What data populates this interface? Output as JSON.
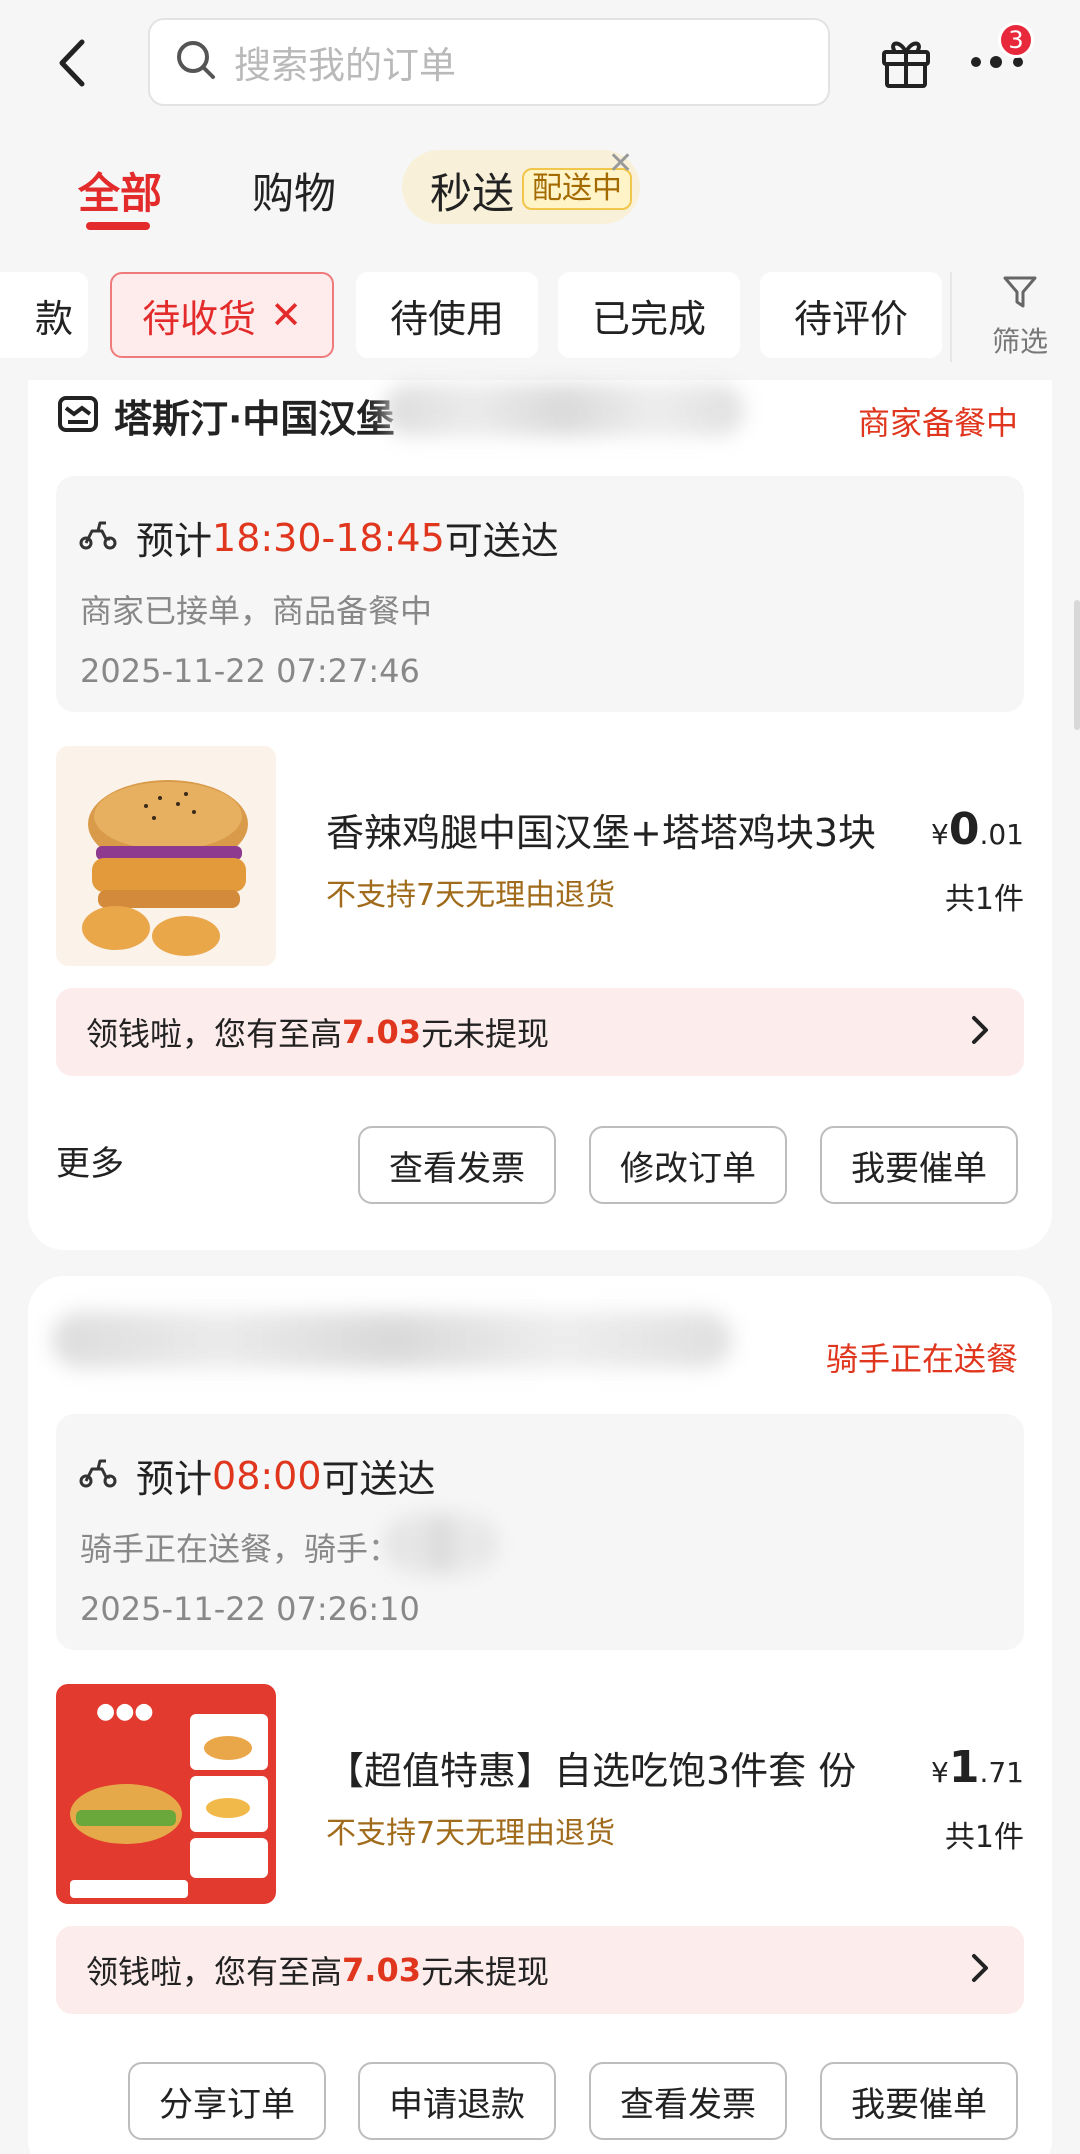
{
  "header": {
    "search_placeholder": "搜索我的订单",
    "badge_count": "3"
  },
  "category_tabs": [
    {
      "label": "全部",
      "active": true
    },
    {
      "label": "购物",
      "active": false
    },
    {
      "label": "秒送",
      "tag": "配送中"
    }
  ],
  "status_chips": {
    "partial": "款",
    "active": "待收货",
    "items": [
      "待使用",
      "已完成",
      "待评价"
    ],
    "filter_label": "筛选"
  },
  "orders": [
    {
      "store_name": "塔斯汀·中国汉堡",
      "status": "商家备餐中",
      "eta_prefix": "预计",
      "eta_time": "18:30-18:45",
      "eta_suffix": "可送达",
      "detail": "商家已接单，商品备餐中",
      "timestamp": "2025-11-22 07:27:46",
      "product_name": "香辣鸡腿中国汉堡+塔塔鸡块3块",
      "product_note": "不支持7天无理由退货",
      "price_currency": "¥",
      "price_int": "0",
      "price_dec": ".01",
      "quantity": "共1件",
      "cash_prefix": "领钱啦，您有至高",
      "cash_amount": "7.03",
      "cash_suffix": "元未提现",
      "more_label": "更多",
      "buttons": [
        "查看发票",
        "修改订单",
        "我要催单"
      ]
    },
    {
      "status": "骑手正在送餐",
      "eta_prefix": "预计",
      "eta_time": "08:00",
      "eta_suffix": "可送达",
      "detail": "骑手正在送餐，骑手：",
      "timestamp": "2025-11-22 07:26:10",
      "product_name": "【超值特惠】自选吃饱3件套 份",
      "product_note": "不支持7天无理由退货",
      "price_currency": "¥",
      "price_int": "1",
      "price_dec": ".71",
      "quantity": "共1件",
      "cash_prefix": "领钱啦，您有至高",
      "cash_amount": "7.03",
      "cash_suffix": "元未提现",
      "buttons": [
        "分享订单",
        "申请退款",
        "查看发票",
        "我要催单"
      ]
    }
  ],
  "colors": {
    "accent_red": "#e32b2b",
    "status_red": "#e0361e",
    "note_brown": "#a06b1b"
  }
}
